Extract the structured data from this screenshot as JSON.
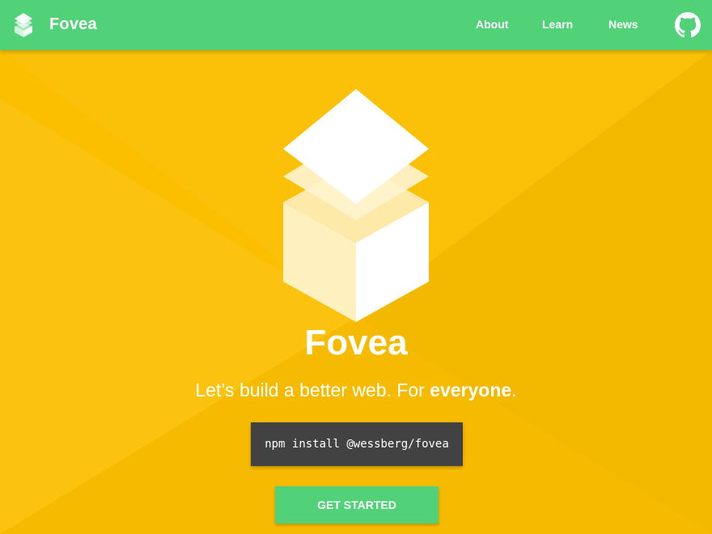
{
  "header": {
    "brand": "Fovea",
    "logo_icon": "stacked-squares-logo-icon",
    "nav": [
      {
        "label": "About"
      },
      {
        "label": "Learn"
      },
      {
        "label": "News"
      }
    ],
    "github_icon": "github-icon"
  },
  "hero": {
    "logo_icon": "stacked-cube-logo-icon",
    "title": "Fovea",
    "tagline_prefix": "Let’s build a better web. For ",
    "tagline_emphasis": "everyone",
    "tagline_suffix": ".",
    "install_command": "npm install @wessberg/fovea",
    "cta_label": "GET STARTED"
  },
  "colors": {
    "nav_bg": "#51d178",
    "hero_bg": "#fbbf00",
    "code_bg": "#424242",
    "text": "#ffffff"
  }
}
